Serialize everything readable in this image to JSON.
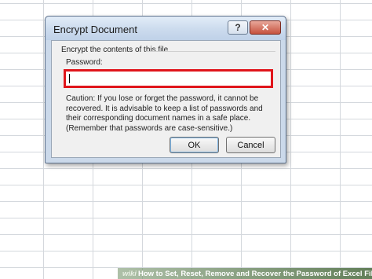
{
  "dialog": {
    "title": "Encrypt Document",
    "help_label": "?",
    "close_label": "✕",
    "group_label": "Encrypt the contents of this file",
    "password_label": "Password:",
    "password_value": "",
    "caution_text": "Caution: If you lose or forget the password, it cannot be recovered. It is advisable to keep a list of passwords and their corresponding document names in a safe place. (Remember that passwords are case-sensitive.)",
    "ok_label": "OK",
    "cancel_label": "Cancel"
  },
  "watermark": {
    "brand": "wiki",
    "text": "How to Set, Reset, Remove and Recover the Password of Excel Files"
  },
  "colors": {
    "highlight": "#e0151b",
    "dialog_background": "#cbd9ea",
    "close_button": "#c6523e"
  }
}
